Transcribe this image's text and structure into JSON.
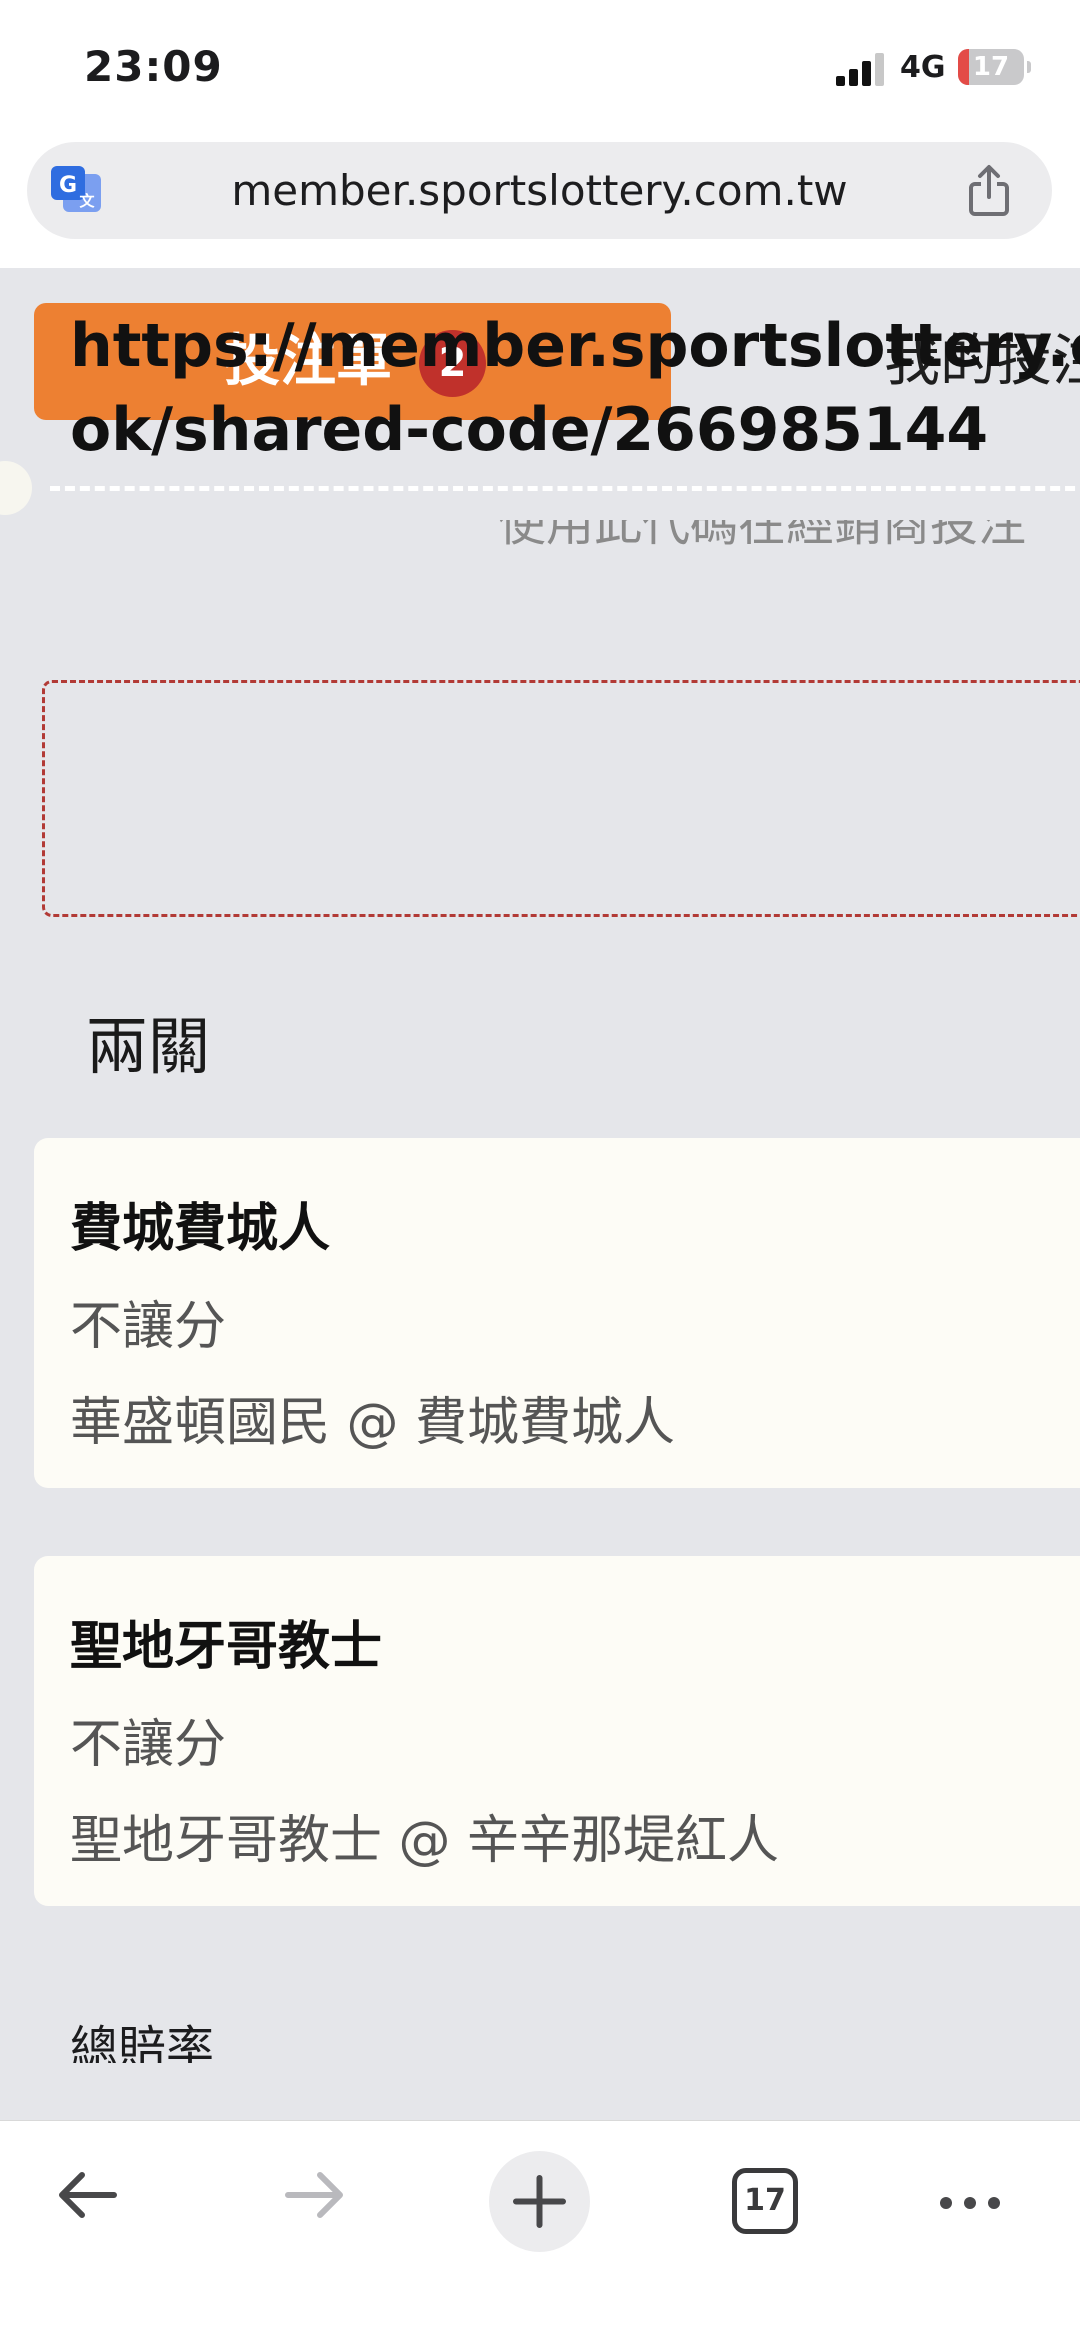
{
  "status_bar": {
    "time": "23:09",
    "network": "4G",
    "battery": "17",
    "battery_level": 0.17
  },
  "url_bar": {
    "url": "member.sportslottery.com.tw",
    "translate_icon": "translate-icon",
    "share_icon": "share-icon"
  },
  "tabs": {
    "active_label": "投注單",
    "active_badge": "2",
    "inactive_label": "我的投注"
  },
  "hint": "使用此代碼在經銷商投注",
  "share_link_line1": "https://member.sportslottery.com.tw/bo",
  "share_link_line2": "ok/shared-code/266985144",
  "section_title": "兩關",
  "bets": [
    {
      "team": "費城費城人",
      "type": "不讓分",
      "match": "華盛頓國民 @ 費城費城人"
    },
    {
      "team": "聖地牙哥教士",
      "type": "不讓分",
      "match": "聖地牙哥教士 @ 辛辛那堤紅人"
    }
  ],
  "total_odds_label": "總賠率",
  "toolbar": {
    "tabs_count": "17",
    "icons": [
      "back-arrow-icon",
      "forward-arrow-icon",
      "plus-icon",
      "tabs-icon",
      "more-icon"
    ]
  },
  "colors": {
    "accent": "#ed8032",
    "badge": "#c0312b",
    "background": "#e5e6ea",
    "card": "#fdfcf6"
  }
}
